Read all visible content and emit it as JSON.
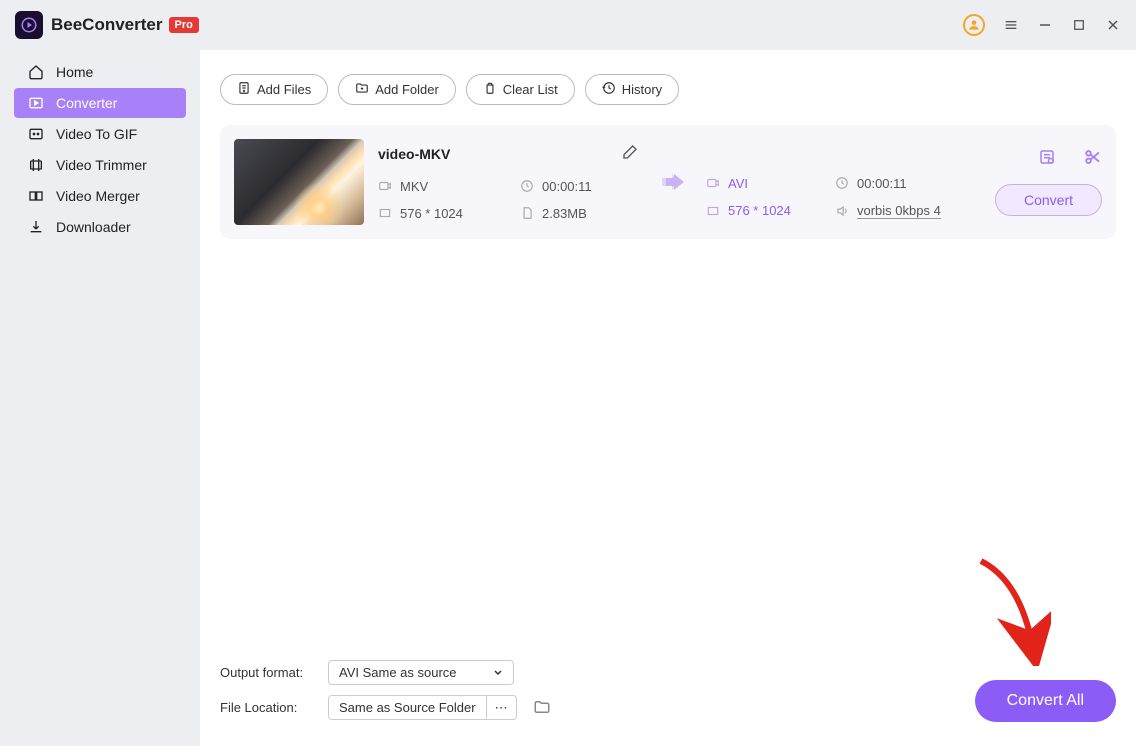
{
  "app": {
    "name": "BeeConverter",
    "badge": "Pro"
  },
  "sidebar": {
    "items": [
      {
        "label": "Home"
      },
      {
        "label": "Converter"
      },
      {
        "label": "Video To GIF"
      },
      {
        "label": "Video Trimmer"
      },
      {
        "label": "Video Merger"
      },
      {
        "label": "Downloader"
      }
    ]
  },
  "toolbar": {
    "add_files": "Add Files",
    "add_folder": "Add Folder",
    "clear_list": "Clear List",
    "history": "History"
  },
  "file": {
    "title": "video-MKV",
    "src_format": "MKV",
    "src_duration": "00:00:11",
    "src_dimensions": "576 * 1024",
    "src_size": "2.83MB",
    "dst_format": "AVI",
    "dst_duration": "00:00:11",
    "dst_dimensions": "576 * 1024",
    "dst_audio": "vorbis 0kbps 4",
    "convert": "Convert"
  },
  "bottom": {
    "output_label": "Output format:",
    "output_value": "AVI Same as source",
    "location_label": "File Location:",
    "location_value": "Same as Source Folder",
    "convert_all": "Convert All"
  }
}
